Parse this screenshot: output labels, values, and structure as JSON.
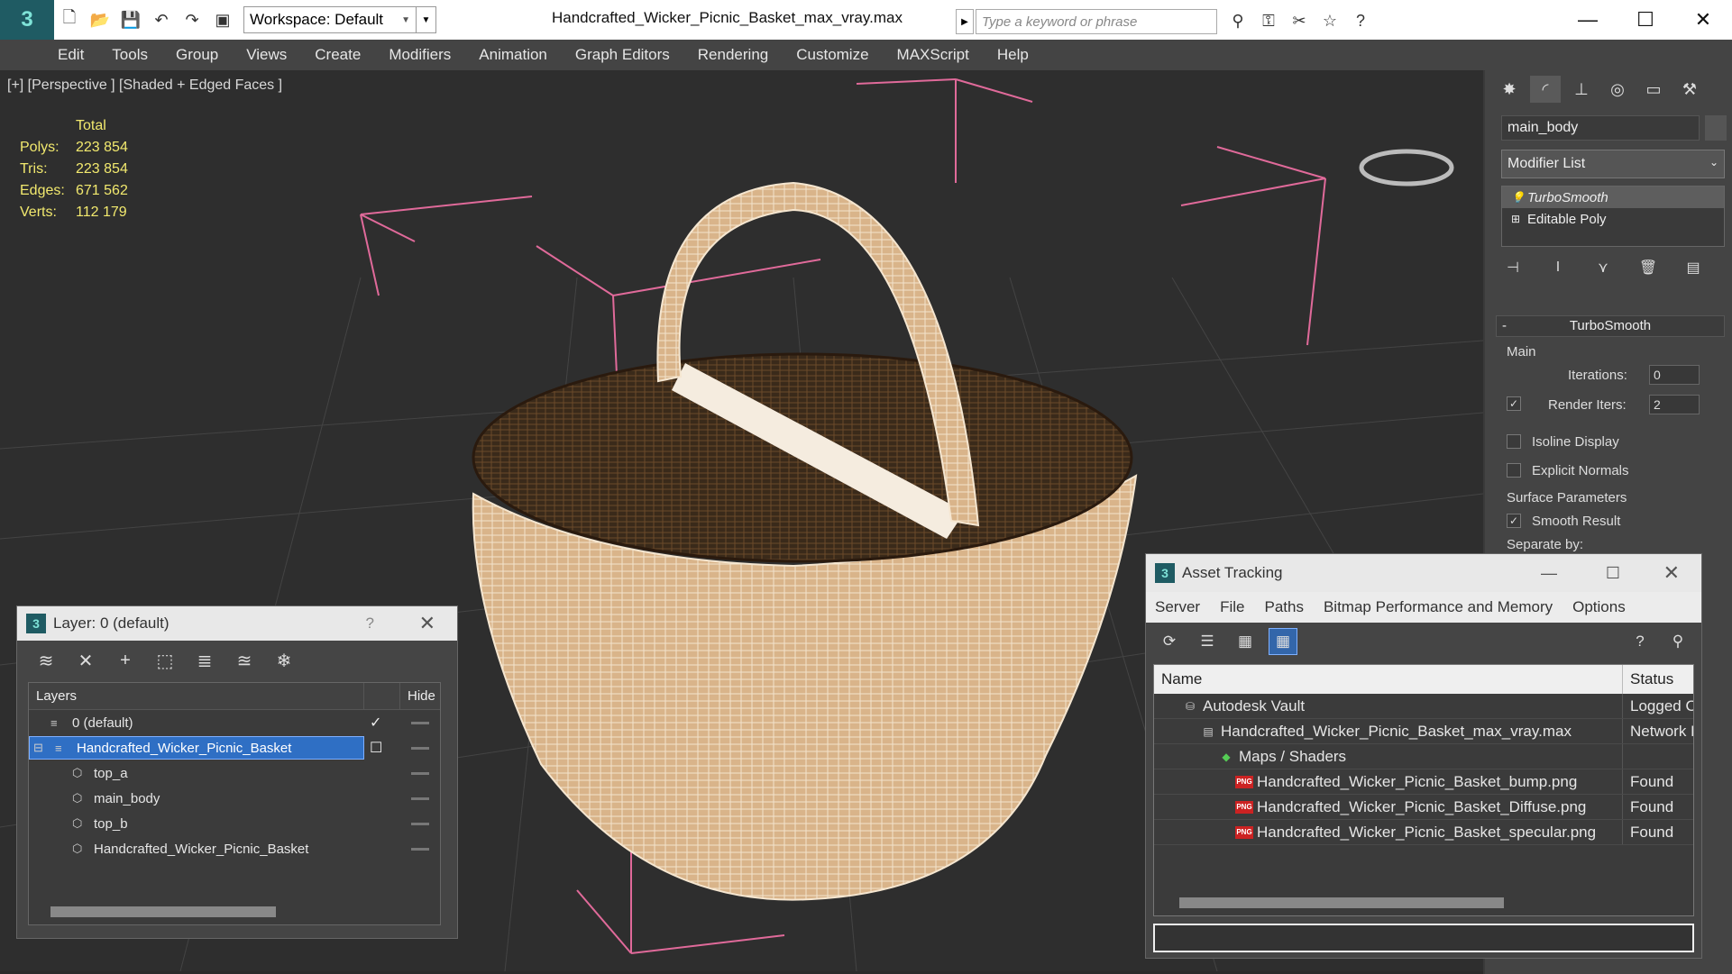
{
  "window": {
    "title": "Handcrafted_Wicker_Picnic_Basket_max_vray.max",
    "workspace": "Workspace: Default",
    "search_placeholder": "Type a keyword or phrase"
  },
  "menu": [
    "Edit",
    "Tools",
    "Group",
    "Views",
    "Create",
    "Modifiers",
    "Animation",
    "Graph Editors",
    "Rendering",
    "Customize",
    "MAXScript",
    "Help"
  ],
  "viewport": {
    "label": "[+] [Perspective ] [Shaded + Edged Faces ]",
    "stats_header": "Total",
    "stats": [
      {
        "label": "Polys:",
        "value": "223 854"
      },
      {
        "label": "Tris:",
        "value": "223 854"
      },
      {
        "label": "Edges:",
        "value": "671 562"
      },
      {
        "label": "Verts:",
        "value": "112 179"
      }
    ]
  },
  "command_panel": {
    "object_name": "main_body",
    "modifier_list": "Modifier List",
    "stack": [
      "TurboSmooth",
      "Editable Poly"
    ],
    "rollout": "TurboSmooth",
    "main_label": "Main",
    "iterations_label": "Iterations:",
    "iterations_value": "0",
    "render_iters_label": "Render Iters:",
    "render_iters_value": "2",
    "isoline": "Isoline Display",
    "explicit_normals": "Explicit Normals",
    "surface_params": "Surface Parameters",
    "smooth_result": "Smooth Result",
    "separate_by": "Separate by:"
  },
  "layer_dialog": {
    "title": "Layer: 0 (default)",
    "help": "?",
    "col_layers": "Layers",
    "col_hide": "Hide",
    "rows": [
      {
        "name": "0 (default)",
        "level": 1
      },
      {
        "name": "Handcrafted_Wicker_Picnic_Basket",
        "level": 0
      },
      {
        "name": "top_a",
        "level": 2
      },
      {
        "name": "main_body",
        "level": 2
      },
      {
        "name": "top_b",
        "level": 2
      },
      {
        "name": "Handcrafted_Wicker_Picnic_Basket",
        "level": 2
      }
    ]
  },
  "asset_dialog": {
    "title": "Asset Tracking",
    "menu": [
      "Server",
      "File",
      "Paths",
      "Bitmap Performance and Memory",
      "Options"
    ],
    "col_name": "Name",
    "col_status": "Status",
    "rows": [
      {
        "name": "Autodesk Vault",
        "status": "Logged O",
        "indent": 30
      },
      {
        "name": "Handcrafted_Wicker_Picnic_Basket_max_vray.max",
        "status": "Network F",
        "indent": 50
      },
      {
        "name": "Maps / Shaders",
        "status": "",
        "indent": 70
      },
      {
        "name": "Handcrafted_Wicker_Picnic_Basket_bump.png",
        "status": "Found",
        "indent": 90
      },
      {
        "name": "Handcrafted_Wicker_Picnic_Basket_Diffuse.png",
        "status": "Found",
        "indent": 90
      },
      {
        "name": "Handcrafted_Wicker_Picnic_Basket_specular.png",
        "status": "Found",
        "indent": 90
      }
    ]
  }
}
